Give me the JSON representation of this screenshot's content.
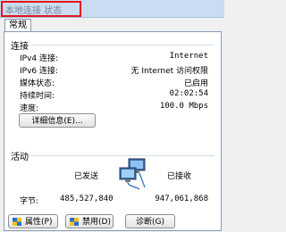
{
  "window": {
    "title": "本地连接 状态"
  },
  "tabs": [
    {
      "label": "常规"
    }
  ],
  "connection": {
    "heading": "连接",
    "rows": [
      {
        "label": "IPv4 连接:",
        "value": "Internet"
      },
      {
        "label": "IPv6 连接:",
        "value": "无 Internet 访问权限"
      },
      {
        "label": "媒体状态:",
        "value": "已启用"
      },
      {
        "label": "持续时间:",
        "value": "02:02:54"
      },
      {
        "label": "速度:",
        "value": "100.0 Mbps"
      }
    ],
    "details_button": "详细信息(E)..."
  },
  "activity": {
    "heading": "活动",
    "sent_label": "已发送",
    "received_label": "已接收",
    "bytes_label": "字节:",
    "bytes_sent": "485,527,840",
    "bytes_received": "947,061,868",
    "icon": "network-computers-icon"
  },
  "buttons": {
    "properties": "属性(P)",
    "disable": "禁用(D)",
    "diagnose": "诊断(G)"
  },
  "colors": {
    "highlight_box": "#e8131a",
    "titlebar": "#c9dcf1"
  }
}
